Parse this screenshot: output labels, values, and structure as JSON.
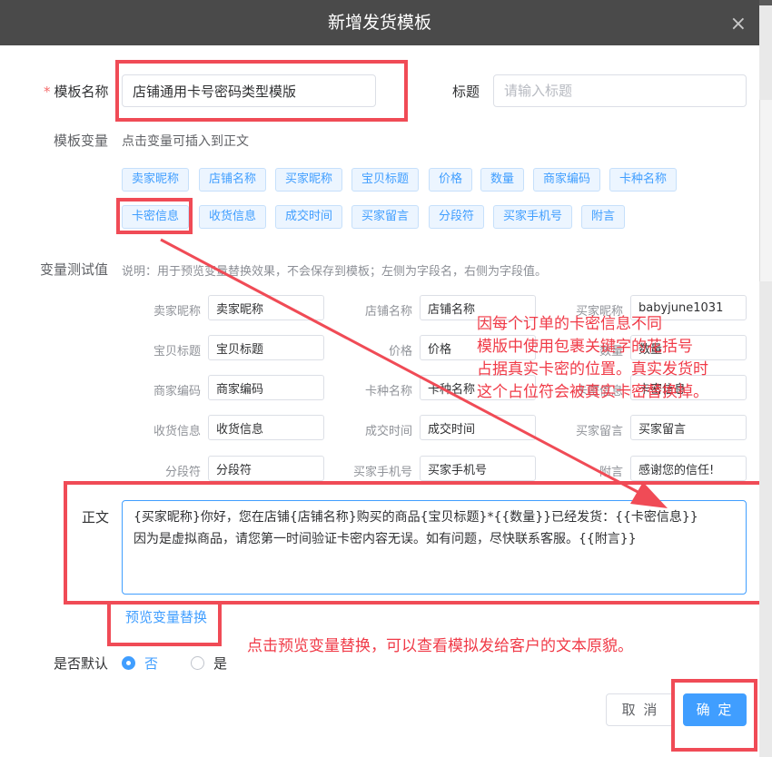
{
  "dialog": {
    "title": "新增发货模板",
    "close_glyph": "×"
  },
  "form": {
    "template_name_label": "模板名称",
    "required_mark": "*",
    "template_name_value": "店铺通用卡号密码类型模版",
    "title_label": "标题",
    "title_placeholder": "请输入标题",
    "variables_label": "模板变量",
    "variables_hint": "点击变量可插入到正文",
    "variables": [
      "卖家昵称",
      "店铺名称",
      "买家昵称",
      "宝贝标题",
      "价格",
      "数量",
      "商家编码",
      "卡种名称",
      "卡密信息",
      "收货信息",
      "成交时间",
      "买家留言",
      "分段符",
      "买家手机号",
      "附言"
    ],
    "test_label": "变量测试值",
    "test_hint": "说明：用于预览变量替换效果，不会保存到模板；左侧为字段名，右侧为字段值。",
    "test_fields": [
      {
        "name": "卖家昵称",
        "value": "卖家昵称"
      },
      {
        "name": "店铺名称",
        "value": "店铺名称"
      },
      {
        "name": "买家昵称",
        "value": "babyjune1031"
      },
      {
        "name": "宝贝标题",
        "value": "宝贝标题"
      },
      {
        "name": "价格",
        "value": "价格"
      },
      {
        "name": "数量",
        "value": "数量"
      },
      {
        "name": "商家编码",
        "value": "商家编码"
      },
      {
        "name": "卡种名称",
        "value": "卡种名称"
      },
      {
        "name": "卡密信息",
        "value": "卡密信息"
      },
      {
        "name": "收货信息",
        "value": "收货信息"
      },
      {
        "name": "成交时间",
        "value": "成交时间"
      },
      {
        "name": "买家留言",
        "value": "买家留言"
      },
      {
        "name": "分段符",
        "value": "分段符"
      },
      {
        "name": "买家手机号",
        "value": "买家手机号"
      },
      {
        "name": "附言",
        "value": "感谢您的信任!"
      }
    ],
    "body_label": "正文",
    "body_value": "{买家昵称}你好，您在店铺{店铺名称}购买的商品{宝贝标题}*{{数量}}已经发货：{{卡密信息}}\n因为是虚拟商品，请您第一时间验证卡密内容无误。如有问题，尽快联系客服。{{附言}}",
    "preview_link": "预览变量替换",
    "default_label": "是否默认",
    "default_no": "否",
    "default_yes": "是",
    "default_selected": "否"
  },
  "footer": {
    "cancel": "取 消",
    "ok": "确 定"
  },
  "annotations": {
    "note1_line1": "因每个订单的卡密信息不同",
    "note1_line2": "模版中使用包裹关键字的花括号",
    "note1_line3": "占据真实卡密的位置。真实发货时",
    "note1_line4": "这个占位符会被真实卡密替换掉。",
    "note2": "点击预览变量替换，可以查看模拟发给客户的文本原貌。",
    "accent_color": "#f04b56",
    "primary_color": "#409eff"
  }
}
